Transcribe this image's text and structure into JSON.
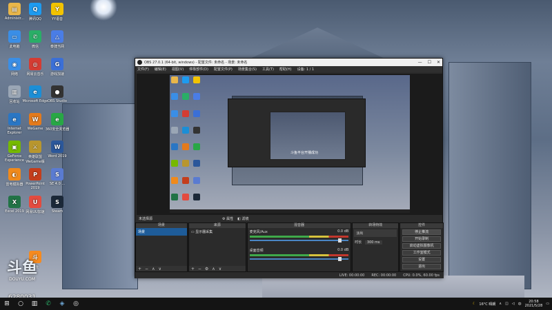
{
  "desktop": {
    "icons": [
      {
        "label": "Administr...",
        "glyph": "▤",
        "color": "#e8b64a"
      },
      {
        "label": "腾讯QQ",
        "glyph": "Q",
        "color": "#1d9bf0"
      },
      {
        "label": "YY语音",
        "glyph": "Y",
        "color": "#f2c300"
      },
      {
        "label": "此电脑",
        "glyph": "▭",
        "color": "#3a8ee6"
      },
      {
        "label": "微信",
        "glyph": "✆",
        "color": "#2aae67"
      },
      {
        "label": "泰捷当网",
        "glyph": "△",
        "color": "#4a7de6"
      },
      {
        "label": "网络",
        "glyph": "◉",
        "color": "#3a8ee6"
      },
      {
        "label": "网易云音乐",
        "glyph": "◎",
        "color": "#d43c33"
      },
      {
        "label": "游戏加速",
        "glyph": "G",
        "color": "#3b6fd6"
      },
      {
        "label": "回收站",
        "glyph": "▥",
        "color": "#9aa6b5"
      },
      {
        "label": "Microsoft Edge",
        "glyph": "e",
        "color": "#1b8ed6"
      },
      {
        "label": "OBS Studio",
        "glyph": "●",
        "color": "#333"
      },
      {
        "label": "Internet Explorer",
        "glyph": "e",
        "color": "#2a76c4"
      },
      {
        "label": "WeGame",
        "glyph": "W",
        "color": "#e37a1c"
      },
      {
        "label": "360安全浏览器",
        "glyph": "e",
        "color": "#28a745"
      },
      {
        "label": "GeForce Experience",
        "glyph": "▣",
        "color": "#76b900"
      },
      {
        "label": "英雄联盟WeGame版",
        "glyph": "⚔",
        "color": "#b8962e"
      },
      {
        "label": "Word 2019",
        "glyph": "W",
        "color": "#2b579a"
      },
      {
        "label": "雷电模拟器",
        "glyph": "◐",
        "color": "#f08a1c"
      },
      {
        "label": "PowerPoint 2019",
        "glyph": "P",
        "color": "#c43e1c"
      },
      {
        "label": "SE 4.0 ...",
        "glyph": "S",
        "color": "#5a7bd1"
      },
      {
        "label": "Excel 2019",
        "glyph": "X",
        "color": "#217346"
      },
      {
        "label": "网易UU加速",
        "glyph": "U",
        "color": "#e34b3f"
      },
      {
        "label": "Steam",
        "glyph": "S",
        "color": "#1b2838"
      },
      {
        "label": "斗鱼",
        "glyph": "斗",
        "color": "#f58a1f"
      }
    ]
  },
  "watermark": {
    "brand": "斗鱼",
    "sub": "DOUYU.COM",
    "viewer_id": "6280031"
  },
  "obs": {
    "title": "OBS 27.0.1 (64-bit, windows) - 配置文件: 未命名 - 场景: 未命名",
    "window_controls": [
      "—",
      "☐",
      "✕"
    ],
    "menu": [
      "文件(F)",
      "编辑(E)",
      "视图(V)",
      "停靠部件(D)",
      "配置文件(P)",
      "场景集合(S)",
      "工具(T)",
      "帮助(H)",
      "设备: 1 / 1"
    ],
    "preview_caption": "斗鱼平台开播成功",
    "source_bar": {
      "label": "未选择源",
      "props": "⚙ 属性",
      "filters": "◧ 滤镜"
    },
    "docks": {
      "scenes": {
        "header": "场景",
        "items": [
          "场景"
        ]
      },
      "sources": {
        "header": "来源",
        "items": [
          "显示器采集"
        ]
      },
      "mixer": {
        "header": "混音器",
        "tracks": [
          {
            "name": "麦克风/Aux",
            "db": "0.0 dB"
          },
          {
            "name": "桌面音频",
            "db": "0.0 dB"
          }
        ]
      },
      "transitions": {
        "header": "转场特效",
        "type": "淡出",
        "duration_label": "时长",
        "duration": "300 ms"
      },
      "controls": {
        "header": "控件",
        "buttons": [
          "停止推流",
          "开始录制",
          "启动虚拟摄像机",
          "工作室模式",
          "设置",
          "退出"
        ]
      }
    },
    "footer_symbols": [
      "+",
      "−",
      "∧",
      "∨"
    ],
    "status": {
      "live": "LIVE: 00:00:00",
      "rec": "REC: 00:00:00",
      "cpu": "CPU: 0.0%, 60.00 fps"
    }
  },
  "taskbar": {
    "weather": "16°C 晴朗",
    "time": "20:58",
    "date": "2021/5/28",
    "ime": "中"
  }
}
